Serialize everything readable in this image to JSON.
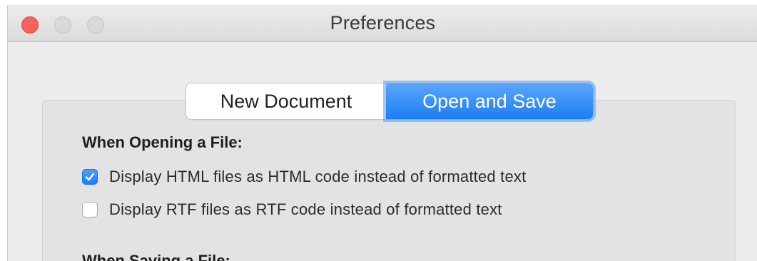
{
  "window": {
    "title": "Preferences"
  },
  "tabs": [
    {
      "label": "New Document",
      "selected": false
    },
    {
      "label": "Open and Save",
      "selected": true
    }
  ],
  "open_section": {
    "heading": "When Opening a File:",
    "options": [
      {
        "label": "Display HTML files as HTML code instead of formatted text",
        "checked": true
      },
      {
        "label": "Display RTF files as RTF code instead of formatted text",
        "checked": false
      }
    ]
  },
  "save_section": {
    "heading": "When Saving a File:"
  },
  "colors": {
    "accent": "#1c7ef2",
    "close_button": "#fc605c",
    "inactive_button": "#d9d9d9"
  }
}
